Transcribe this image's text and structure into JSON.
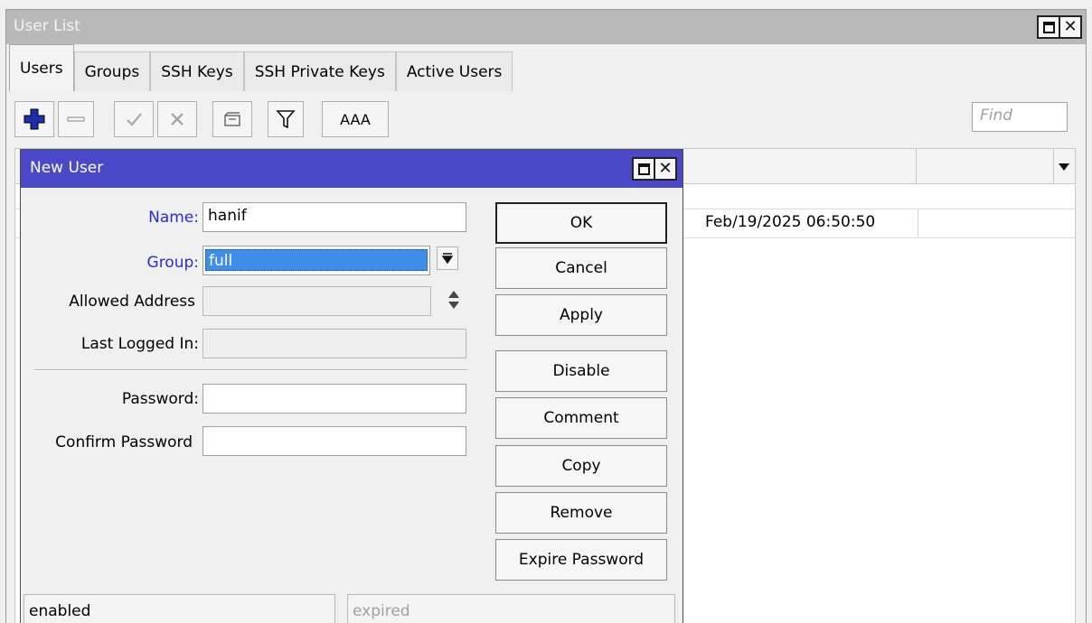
{
  "outer_window": {
    "title": "User List",
    "tabs": [
      {
        "label": "Users",
        "active": true
      },
      {
        "label": "Groups"
      },
      {
        "label": "SSH Keys"
      },
      {
        "label": "SSH Private Keys"
      },
      {
        "label": "Active Users"
      }
    ],
    "toolbar": {
      "aaa_label": "AAA",
      "find_placeholder": "Find",
      "icons": [
        "add-icon",
        "remove-icon",
        "enable-icon",
        "disable-icon",
        "comment-icon",
        "filter-icon"
      ]
    },
    "table": {
      "rows": [
        {
          "last_logged_in": "Feb/19/2025 06:50:50"
        }
      ]
    }
  },
  "dialog": {
    "title": "New User",
    "fields": {
      "name_label": "Name:",
      "name_value": "hanif",
      "group_label": "Group:",
      "group_value": "full",
      "allowed_address_label": "Allowed Address",
      "allowed_address_value": "",
      "last_logged_in_label": "Last Logged In:",
      "last_logged_in_value": "",
      "password_label": "Password:",
      "password_value": "",
      "confirm_password_label": "Confirm Password",
      "confirm_password_value": ""
    },
    "buttons": {
      "ok": "OK",
      "cancel": "Cancel",
      "apply": "Apply",
      "disable": "Disable",
      "comment": "Comment",
      "copy": "Copy",
      "remove": "Remove",
      "expire_password": "Expire Password"
    },
    "status": {
      "state": "enabled",
      "expired": "expired"
    }
  },
  "colors": {
    "dialog_titlebar": "#4949c8",
    "outer_titlebar": "#b9b9b9",
    "required_label": "#2b2bd6",
    "selection": "#3d8ee8",
    "add_icon": "#1b2fa8"
  }
}
